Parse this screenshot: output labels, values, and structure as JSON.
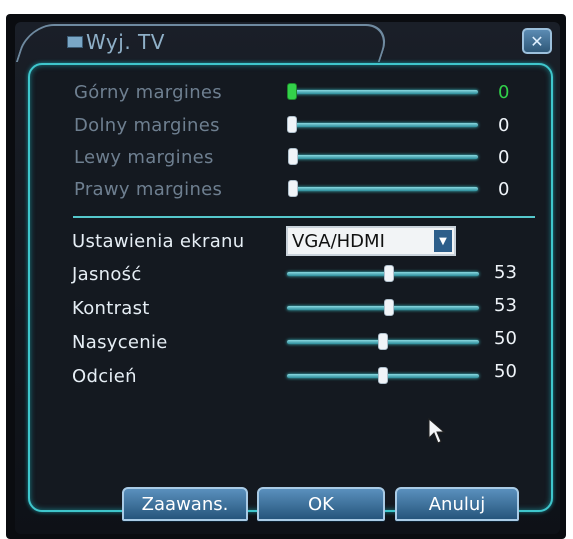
{
  "window": {
    "title": "Wyj. TV",
    "close_symbol": "✕"
  },
  "margins": [
    {
      "label": "Górny margines",
      "value": "0",
      "level": 0,
      "active": true
    },
    {
      "label": "Dolny margines",
      "value": "0",
      "level": 0,
      "active": false
    },
    {
      "label": "Lewy margines",
      "value": "0",
      "level": 0,
      "active": false
    },
    {
      "label": "Prawy margines",
      "value": "0",
      "level": 0,
      "active": false
    }
  ],
  "screen": {
    "label": "Ustawienia ekranu",
    "selected": "VGA/HDMI"
  },
  "sliders": [
    {
      "label": "Jasność",
      "value": "53",
      "level": 0.53
    },
    {
      "label": "Kontrast",
      "value": "53",
      "level": 0.53
    },
    {
      "label": "Nasycenie",
      "value": "50",
      "level": 0.5
    },
    {
      "label": "Odcień",
      "value": "50",
      "level": 0.5
    }
  ],
  "buttons": {
    "advanced": "Zaawans.",
    "ok": "OK",
    "cancel": "Anuluj"
  },
  "colors": {
    "accent": "#3fc6cc",
    "active_value": "#31d04a"
  }
}
